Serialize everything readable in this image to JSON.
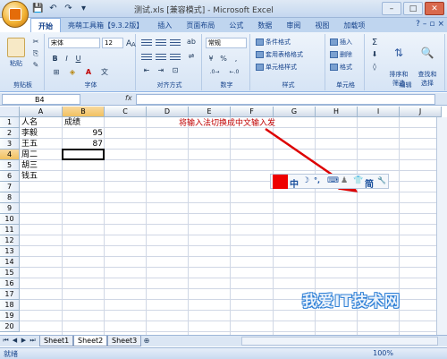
{
  "window": {
    "title": "测试.xls [兼容模式] - Microsoft Excel",
    "controls": [
      "–",
      "□",
      "✕"
    ]
  },
  "tabs": [
    "开始",
    "亮萌工具箱【9.3.2版】",
    "插入",
    "页面布局",
    "公式",
    "数据",
    "审阅",
    "视图",
    "加载项"
  ],
  "ribbon": {
    "clipboard": {
      "paste": "粘贴",
      "label": "剪贴板"
    },
    "font": {
      "name": "宋体",
      "size": "12",
      "bold": "B",
      "italic": "I",
      "underline": "U",
      "font_color": "A",
      "label": "字体",
      "grow": "A",
      "shrink": "A"
    },
    "alignment": {
      "label": "对齐方式"
    },
    "number": {
      "format": "常规",
      "percent": "%",
      "comma": ",",
      "label": "数字"
    },
    "styles": {
      "cond_format": "条件格式",
      "table_format": "套用表格格式",
      "cell_style": "单元格样式",
      "label": "样式"
    },
    "cells": {
      "insert": "插入",
      "delete": "删除",
      "format": "格式",
      "label": "单元格"
    },
    "editing": {
      "sum": "Σ",
      "sort": "排序和\n筛选",
      "find": "查找和\n选择",
      "label": "编辑"
    }
  },
  "formula_bar": {
    "name_box": "B4",
    "fx": "fx",
    "value": ""
  },
  "columns": [
    "A",
    "B",
    "C",
    "D",
    "E",
    "F",
    "G",
    "H",
    "I",
    "J"
  ],
  "rows": [
    "1",
    "2",
    "3",
    "4",
    "5",
    "6",
    "7",
    "8",
    "9",
    "10",
    "11",
    "12",
    "13",
    "14",
    "15",
    "16",
    "17",
    "18",
    "19",
    "20"
  ],
  "cells": {
    "A1": "人名",
    "B1": "成绩",
    "A2": "李毅",
    "B2": "95",
    "A3": "王五",
    "B3": "87",
    "A4": "周二",
    "A5": "胡三",
    "A6": "钱五"
  },
  "selected_cell": "B4",
  "annotation": "将输入法切换成中文输入发",
  "ime_bar": {
    "mode": "中",
    "moon": "☽",
    "punct": "°,",
    "keyboard": "⌨",
    "skin": "♟",
    "shirt": "👕",
    "simp": "简",
    "tool": "🔧"
  },
  "watermark": "我爱IT技术网",
  "sheets": [
    "Sheet1",
    "Sheet2",
    "Sheet3"
  ],
  "active_sheet": "Sheet2",
  "status": {
    "ready": "就绪",
    "zoom": "100%"
  }
}
